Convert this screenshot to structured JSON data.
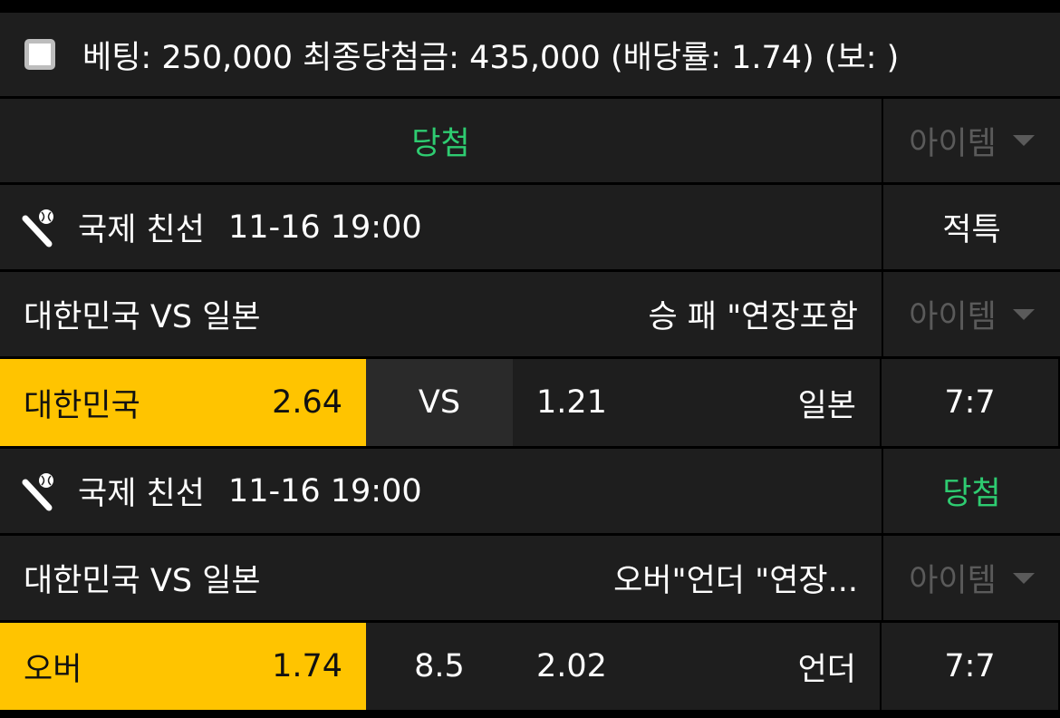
{
  "summary": {
    "text": "베팅: 250,000 최종당첨금: 435,000 (배당률: 1.74) (보: )"
  },
  "result_header": {
    "status": "당첨",
    "item_label": "아이템"
  },
  "matches": [
    {
      "league": "국제 친선",
      "datetime": "11-16 19:00",
      "side_status": "적특",
      "teams": "대한민국 VS 일본",
      "market": "승 패 \"연장포함",
      "item_label": "아이템",
      "home": "대한민국",
      "home_odds": "2.64",
      "middle": "VS",
      "away_odds": "1.21",
      "away": "일본",
      "score": "7:7"
    },
    {
      "league": "국제 친선",
      "datetime": "11-16 19:00",
      "side_status": "당첨",
      "teams": "대한민국 VS 일본",
      "market": "오버\"언더 \"연장...",
      "item_label": "아이템",
      "home": "오버",
      "home_odds": "1.74",
      "middle": "8.5",
      "away_odds": "2.02",
      "away": "언더",
      "score": "7:7"
    }
  ],
  "colors": {
    "selected": "#ffc400",
    "win": "#2ecc71",
    "row_bg": "#1e1e1e"
  }
}
